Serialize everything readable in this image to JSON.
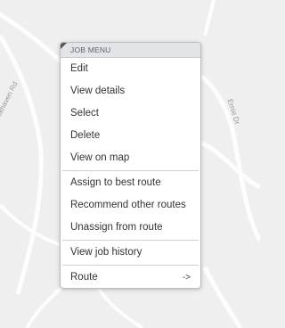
{
  "map": {
    "road_labels": [
      "W Brookhaven Rd",
      "Ernie Dr"
    ]
  },
  "menu": {
    "header": "JOB MENU",
    "items": [
      "Edit",
      "View details",
      "Select",
      "Delete",
      "View on map"
    ],
    "route_items": [
      "Assign to best route",
      "Recommend other routes",
      "Unassign from route"
    ],
    "history_item": "View job history",
    "route_label": "Route",
    "route_arrow": "->"
  }
}
